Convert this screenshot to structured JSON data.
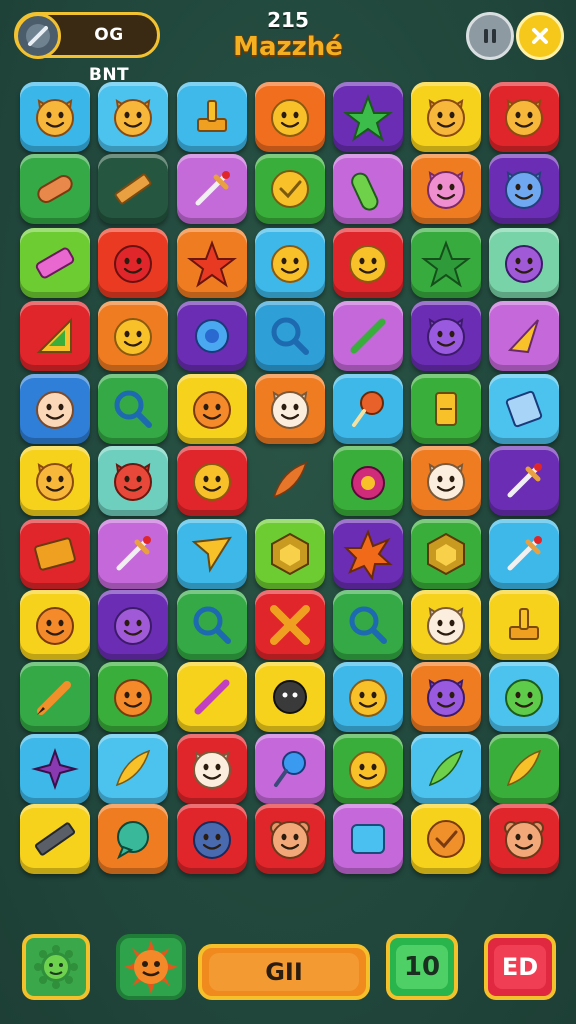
{
  "header": {
    "badge_label": "OG BNT",
    "score": "215",
    "title": "Mazzhé"
  },
  "board": {
    "rows": [
      [
        {
          "color": "#3ab6e8",
          "icon": "cat-face"
        },
        {
          "color": "#4cc2ee",
          "icon": "cat-face"
        },
        {
          "color": "#3fb8ea",
          "icon": "crown-block"
        },
        {
          "color": "#f26e1f",
          "icon": "smiley"
        },
        {
          "color": "#6a2db3",
          "icon": "star-leaf"
        },
        {
          "color": "#f6d21c",
          "icon": "cat-face"
        },
        {
          "color": "#e0262b",
          "icon": "cat-face"
        }
      ],
      [
        {
          "color": "#34a945",
          "icon": "bandage"
        },
        {
          "color": "#25563f",
          "icon": "ruler"
        },
        {
          "color": "#c46bd9",
          "icon": "dagger"
        },
        {
          "color": "#3aae3a",
          "icon": "check-coin"
        },
        {
          "color": "#c568da",
          "icon": "leaf-pill"
        },
        {
          "color": "#f07c22",
          "icon": "pink-cat"
        },
        {
          "color": "#6a2db3",
          "icon": "blue-cat"
        }
      ],
      [
        {
          "color": "#6dcc32",
          "icon": "eraser"
        },
        {
          "color": "#ea3a22",
          "icon": "red-face"
        },
        {
          "color": "#f07c22",
          "icon": "red-star"
        },
        {
          "color": "#3db8e8",
          "icon": "smiley"
        },
        {
          "color": "#e0262b",
          "icon": "smiley"
        },
        {
          "color": "#38ab3f",
          "icon": "green-star"
        },
        {
          "color": "#79d3a8",
          "icon": "purple-face"
        }
      ],
      [
        {
          "color": "#e0262b",
          "icon": "triangle-ruler"
        },
        {
          "color": "#f07c22",
          "icon": "smiley"
        },
        {
          "color": "#6a2db3",
          "icon": "blue-gear"
        },
        {
          "color": "#2f9fd8",
          "icon": "magnifier"
        },
        {
          "color": "#c568da",
          "icon": "green-stick"
        },
        {
          "color": "#6a2db3",
          "icon": "purple-cat"
        },
        {
          "color": "#c568da",
          "icon": "arrow-head"
        }
      ],
      [
        {
          "color": "#2f7fd8",
          "icon": "baby-face"
        },
        {
          "color": "#34a945",
          "icon": "magnifier"
        },
        {
          "color": "#f6d21c",
          "icon": "orange-face"
        },
        {
          "color": "#f07c22",
          "icon": "cat-white"
        },
        {
          "color": "#3db8e8",
          "icon": "lollipop"
        },
        {
          "color": "#3aae3a",
          "icon": "yellow-door"
        },
        {
          "color": "#4cc2ee",
          "icon": "box-tag"
        }
      ],
      [
        {
          "color": "#f6d21c",
          "icon": "cat-face"
        },
        {
          "color": "#6fcfbe",
          "icon": "red-cat"
        },
        {
          "color": "#e0262b",
          "icon": "smiley"
        },
        {
          "color": "empty",
          "icon": "orange-leaf"
        },
        {
          "color": "#3aae3a",
          "icon": "pink-tomato"
        },
        {
          "color": "#f07c22",
          "icon": "cat-white"
        },
        {
          "color": "#6a2db3",
          "icon": "dagger"
        }
      ],
      [
        {
          "color": "#e0262b",
          "icon": "brick"
        },
        {
          "color": "#c568da",
          "icon": "dagger"
        },
        {
          "color": "#3db8e8",
          "icon": "paper-plane"
        },
        {
          "color": "#6dcc32",
          "icon": "gem-box"
        },
        {
          "color": "#6a2db3",
          "icon": "orange-star"
        },
        {
          "color": "#3aae3a",
          "icon": "gem-box"
        },
        {
          "color": "#3db8e8",
          "icon": "dagger"
        }
      ],
      [
        {
          "color": "#f6d21c",
          "icon": "orange-face"
        },
        {
          "color": "#6a2db3",
          "icon": "purple-face"
        },
        {
          "color": "#34a945",
          "icon": "magnifier"
        },
        {
          "color": "#e0262b",
          "icon": "cross-sticks"
        },
        {
          "color": "#34a945",
          "icon": "magnifier"
        },
        {
          "color": "#f6d21c",
          "icon": "cat-white"
        },
        {
          "color": "#f6d21c",
          "icon": "crown-block"
        }
      ],
      [
        {
          "color": "#34a945",
          "icon": "pencil"
        },
        {
          "color": "#3aae3a",
          "icon": "orange-face"
        },
        {
          "color": "#f6d21c",
          "icon": "pink-stick"
        },
        {
          "color": "#f6d21c",
          "icon": "spiky-ball"
        },
        {
          "color": "#3db8e8",
          "icon": "smiley"
        },
        {
          "color": "#f07c22",
          "icon": "purple-cat"
        },
        {
          "color": "#4cc2ee",
          "icon": "green-face"
        }
      ],
      [
        {
          "color": "#3db8e8",
          "icon": "purple-star"
        },
        {
          "color": "#4cc2ee",
          "icon": "yellow-leaf"
        },
        {
          "color": "#e0262b",
          "icon": "cat-white"
        },
        {
          "color": "#c568da",
          "icon": "lollipop-blue"
        },
        {
          "color": "#3aae3a",
          "icon": "smiley"
        },
        {
          "color": "#4cc2ee",
          "icon": "green-leaf"
        },
        {
          "color": "#3aae3a",
          "icon": "yellow-leaf"
        }
      ],
      [
        {
          "color": "#f6d21c",
          "icon": "ruler-gray"
        },
        {
          "color": "#f07c22",
          "icon": "speech-bubble"
        },
        {
          "color": "#e0262b",
          "icon": "blue-face"
        },
        {
          "color": "#e0262b",
          "icon": "bear-face"
        },
        {
          "color": "#c568da",
          "icon": "blue-square"
        },
        {
          "color": "#f6d21c",
          "icon": "check-coin-orange"
        },
        {
          "color": "#e0262b",
          "icon": "bear-face"
        }
      ]
    ]
  },
  "footer": {
    "bar_label": "GII",
    "ten_label": "10",
    "red_label": "ED"
  }
}
